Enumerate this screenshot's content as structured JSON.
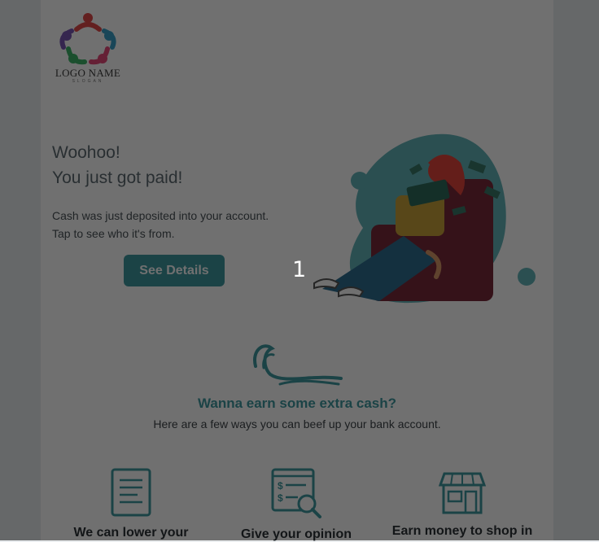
{
  "brand": {
    "logo_name": "LOGO NAME",
    "slogan": "SLOGAN"
  },
  "hero": {
    "headline_line1": "Woohoo!",
    "headline_line2": "You just got paid!",
    "lead_line1": "Cash was just deposited into your account.",
    "lead_line2": "Tap to see who it's from.",
    "cta_label": "See Details"
  },
  "overlay_marker": "1",
  "earn": {
    "title": "Wanna earn some extra cash?",
    "subtitle": "Here are a few ways you can beef up your bank account."
  },
  "features": [
    {
      "label": "We can lower your",
      "icon": "document-list-icon"
    },
    {
      "label": "Give your opinion",
      "icon": "survey-search-icon"
    },
    {
      "label": "Earn money to shop in",
      "icon": "storefront-icon"
    }
  ],
  "colors": {
    "accent": "#3e98a0",
    "chair": "#7a2a3a",
    "hair": "#e4463b",
    "overlay": "rgba(0,0,0,0.56)"
  }
}
